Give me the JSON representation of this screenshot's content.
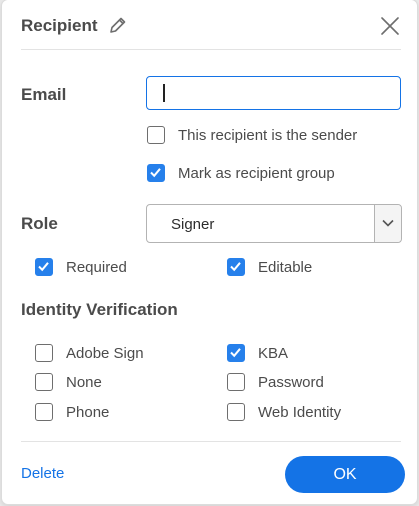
{
  "dialog": {
    "title": "Recipient"
  },
  "email": {
    "label": "Email",
    "value": ""
  },
  "options": {
    "sender": {
      "label": "This recipient is the sender",
      "checked": false
    },
    "group": {
      "label": "Mark as recipient group",
      "checked": true
    }
  },
  "role": {
    "label": "Role",
    "selected": "Signer",
    "required": {
      "label": "Required",
      "checked": true
    },
    "editable": {
      "label": "Editable",
      "checked": true
    }
  },
  "identity": {
    "label": "Identity Verification",
    "options": [
      {
        "label": "Adobe Sign",
        "checked": false
      },
      {
        "label": "KBA",
        "checked": true
      },
      {
        "label": "None",
        "checked": false
      },
      {
        "label": "Password",
        "checked": false
      },
      {
        "label": "Phone",
        "checked": false
      },
      {
        "label": "Web Identity",
        "checked": false
      }
    ]
  },
  "footer": {
    "delete_label": "Delete",
    "ok_label": "OK"
  },
  "colors": {
    "accent": "#1473e6",
    "checkbox": "#2680eb"
  },
  "icons": {
    "edit": "pencil-icon",
    "close": "close-icon",
    "dropdown": "chevron-down-icon",
    "check": "checkmark-icon"
  }
}
